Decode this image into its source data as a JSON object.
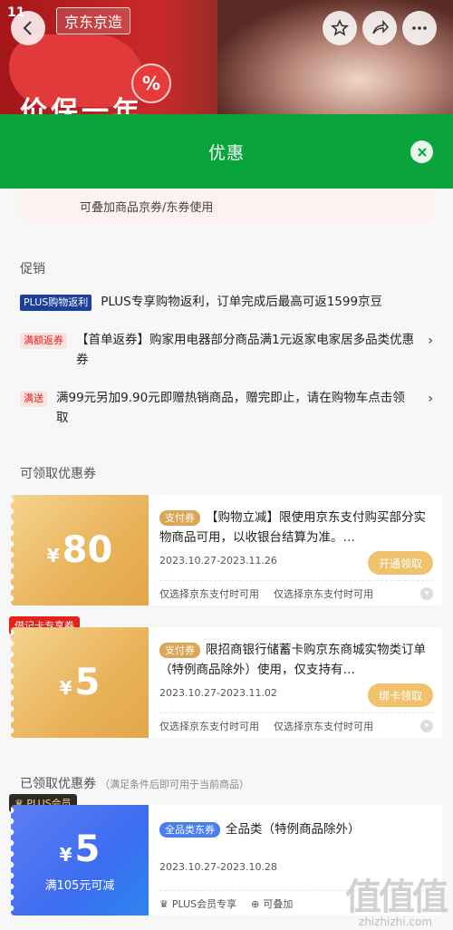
{
  "hero": {
    "event_logo": "11",
    "brand": "京东京造",
    "promo": "价保一年",
    "percent": "%"
  },
  "sheet": {
    "title": "优惠"
  },
  "tip": "可叠加商品京券/东券使用",
  "promotions_title": "促销",
  "promotions": [
    {
      "tag": "PLUS购物返利",
      "style": "plus",
      "text": "PLUS专享购物返利，订单完成后最高可返1599京豆",
      "chevron": ""
    },
    {
      "tag": "满额返券",
      "style": "red",
      "text": "【首单返券】购家用电器部分商品满1元返家电家居多品类优惠券",
      "chevron": "›"
    },
    {
      "tag": "满送",
      "style": "red",
      "text": "满99元另加9.90元即赠热销商品，赠完即止，请在购物车点击领取",
      "chevron": "›"
    }
  ],
  "available_title": "可领取优惠券",
  "coupons": [
    {
      "badge": "",
      "yen": "¥",
      "amount": "80",
      "cond": "",
      "type": "支付券",
      "title": "【购物立减】限使用京东支付购买部分实物商品可用，以收银台结算为准。…",
      "date": "2023.10.27-2023.11.26",
      "action": "开通领取",
      "notes": [
        "仅选择京东支付时可用",
        "仅选择京东支付时可用"
      ]
    },
    {
      "badge": "借记卡专享券",
      "yen": "¥",
      "amount": "5",
      "cond": "",
      "type": "支付券",
      "title": "限招商银行储蓄卡购京东商城实物类订单（特例商品除外）使用，仅支持有…",
      "date": "2023.10.27-2023.11.02",
      "action": "绑卡领取",
      "notes": [
        "仅选择京东支付时可用",
        "仅选择京东支付时可用"
      ]
    }
  ],
  "received_title": "已领取优惠券",
  "received_sub": "（满足条件后即可用于当前商品）",
  "received": {
    "badge": "PLUS会员",
    "yen": "¥",
    "amount": "5",
    "cond": "满105元可减",
    "type": "全品类东券",
    "title": "全品类（特例商品除外）",
    "date": "2023.10.27-2023.10.28",
    "notes": [
      "PLUS会员专享",
      "可叠加"
    ]
  },
  "watermark": {
    "big": "值值值",
    "small": "zhizhizhi.com"
  },
  "colors": {
    "header_green": "#0aa43c",
    "coupon_gold": "#e9b259",
    "coupon_blue": "#3c6df0",
    "jd_red": "#e2231a"
  }
}
